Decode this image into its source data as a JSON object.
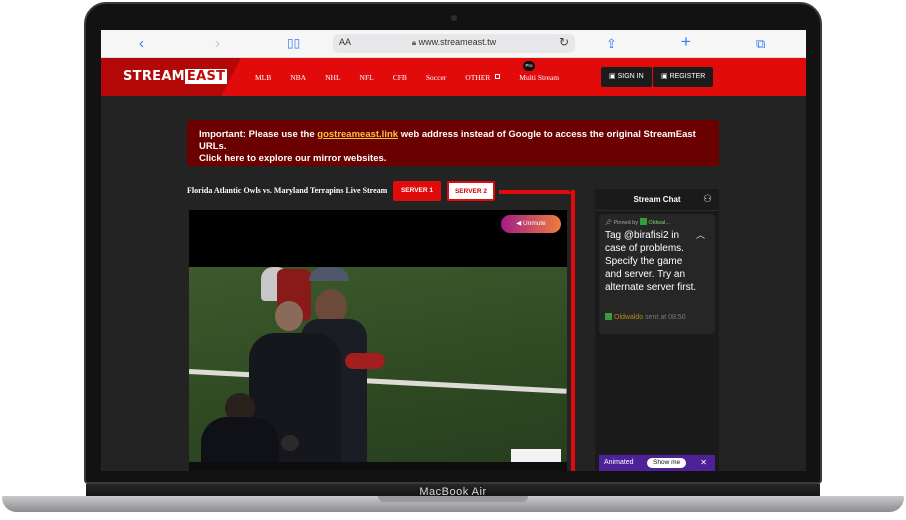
{
  "device": {
    "label": "MacBook Air"
  },
  "browser": {
    "text_size_label": "AA",
    "url": "www.streameast.tw"
  },
  "site": {
    "logo_part1": "STREAM",
    "logo_part2": "EAST",
    "nav": [
      "MLB",
      "NBA",
      "NHL",
      "NFL",
      "CFB",
      "Soccer",
      "OTHER",
      "Multi Stream"
    ],
    "pro_badge": "Pro",
    "sign_in": "SIGN IN",
    "register": "REGISTER"
  },
  "notice": {
    "prefix": "Important: Please use the ",
    "link": "gostreameast.link",
    "suffix": " web address instead of Google to access the original StreamEast URLs.",
    "line2": "Click here to explore our mirror websites."
  },
  "stream": {
    "title": "Florida Atlantic Owls vs. Maryland Terrapins Live Stream",
    "server1": "SERVER 1",
    "server2": "SERVER 2",
    "unmute": "Unmute"
  },
  "chat": {
    "title": "Stream Chat",
    "pinned_by": "Pinned by",
    "pinned_user_short": "Oldwal...",
    "message": "Tag @birafisi2 in case of problems. Specify the game and server. Try an alternate server first.",
    "author": "Oldwaldo",
    "sent_at": "sent at 08:50",
    "animated_label": "Animated",
    "show_me": "Show me"
  },
  "colors": {
    "brand_red": "#e20b0b",
    "notice_bg": "#6b0000",
    "link": "#f7c33d"
  }
}
